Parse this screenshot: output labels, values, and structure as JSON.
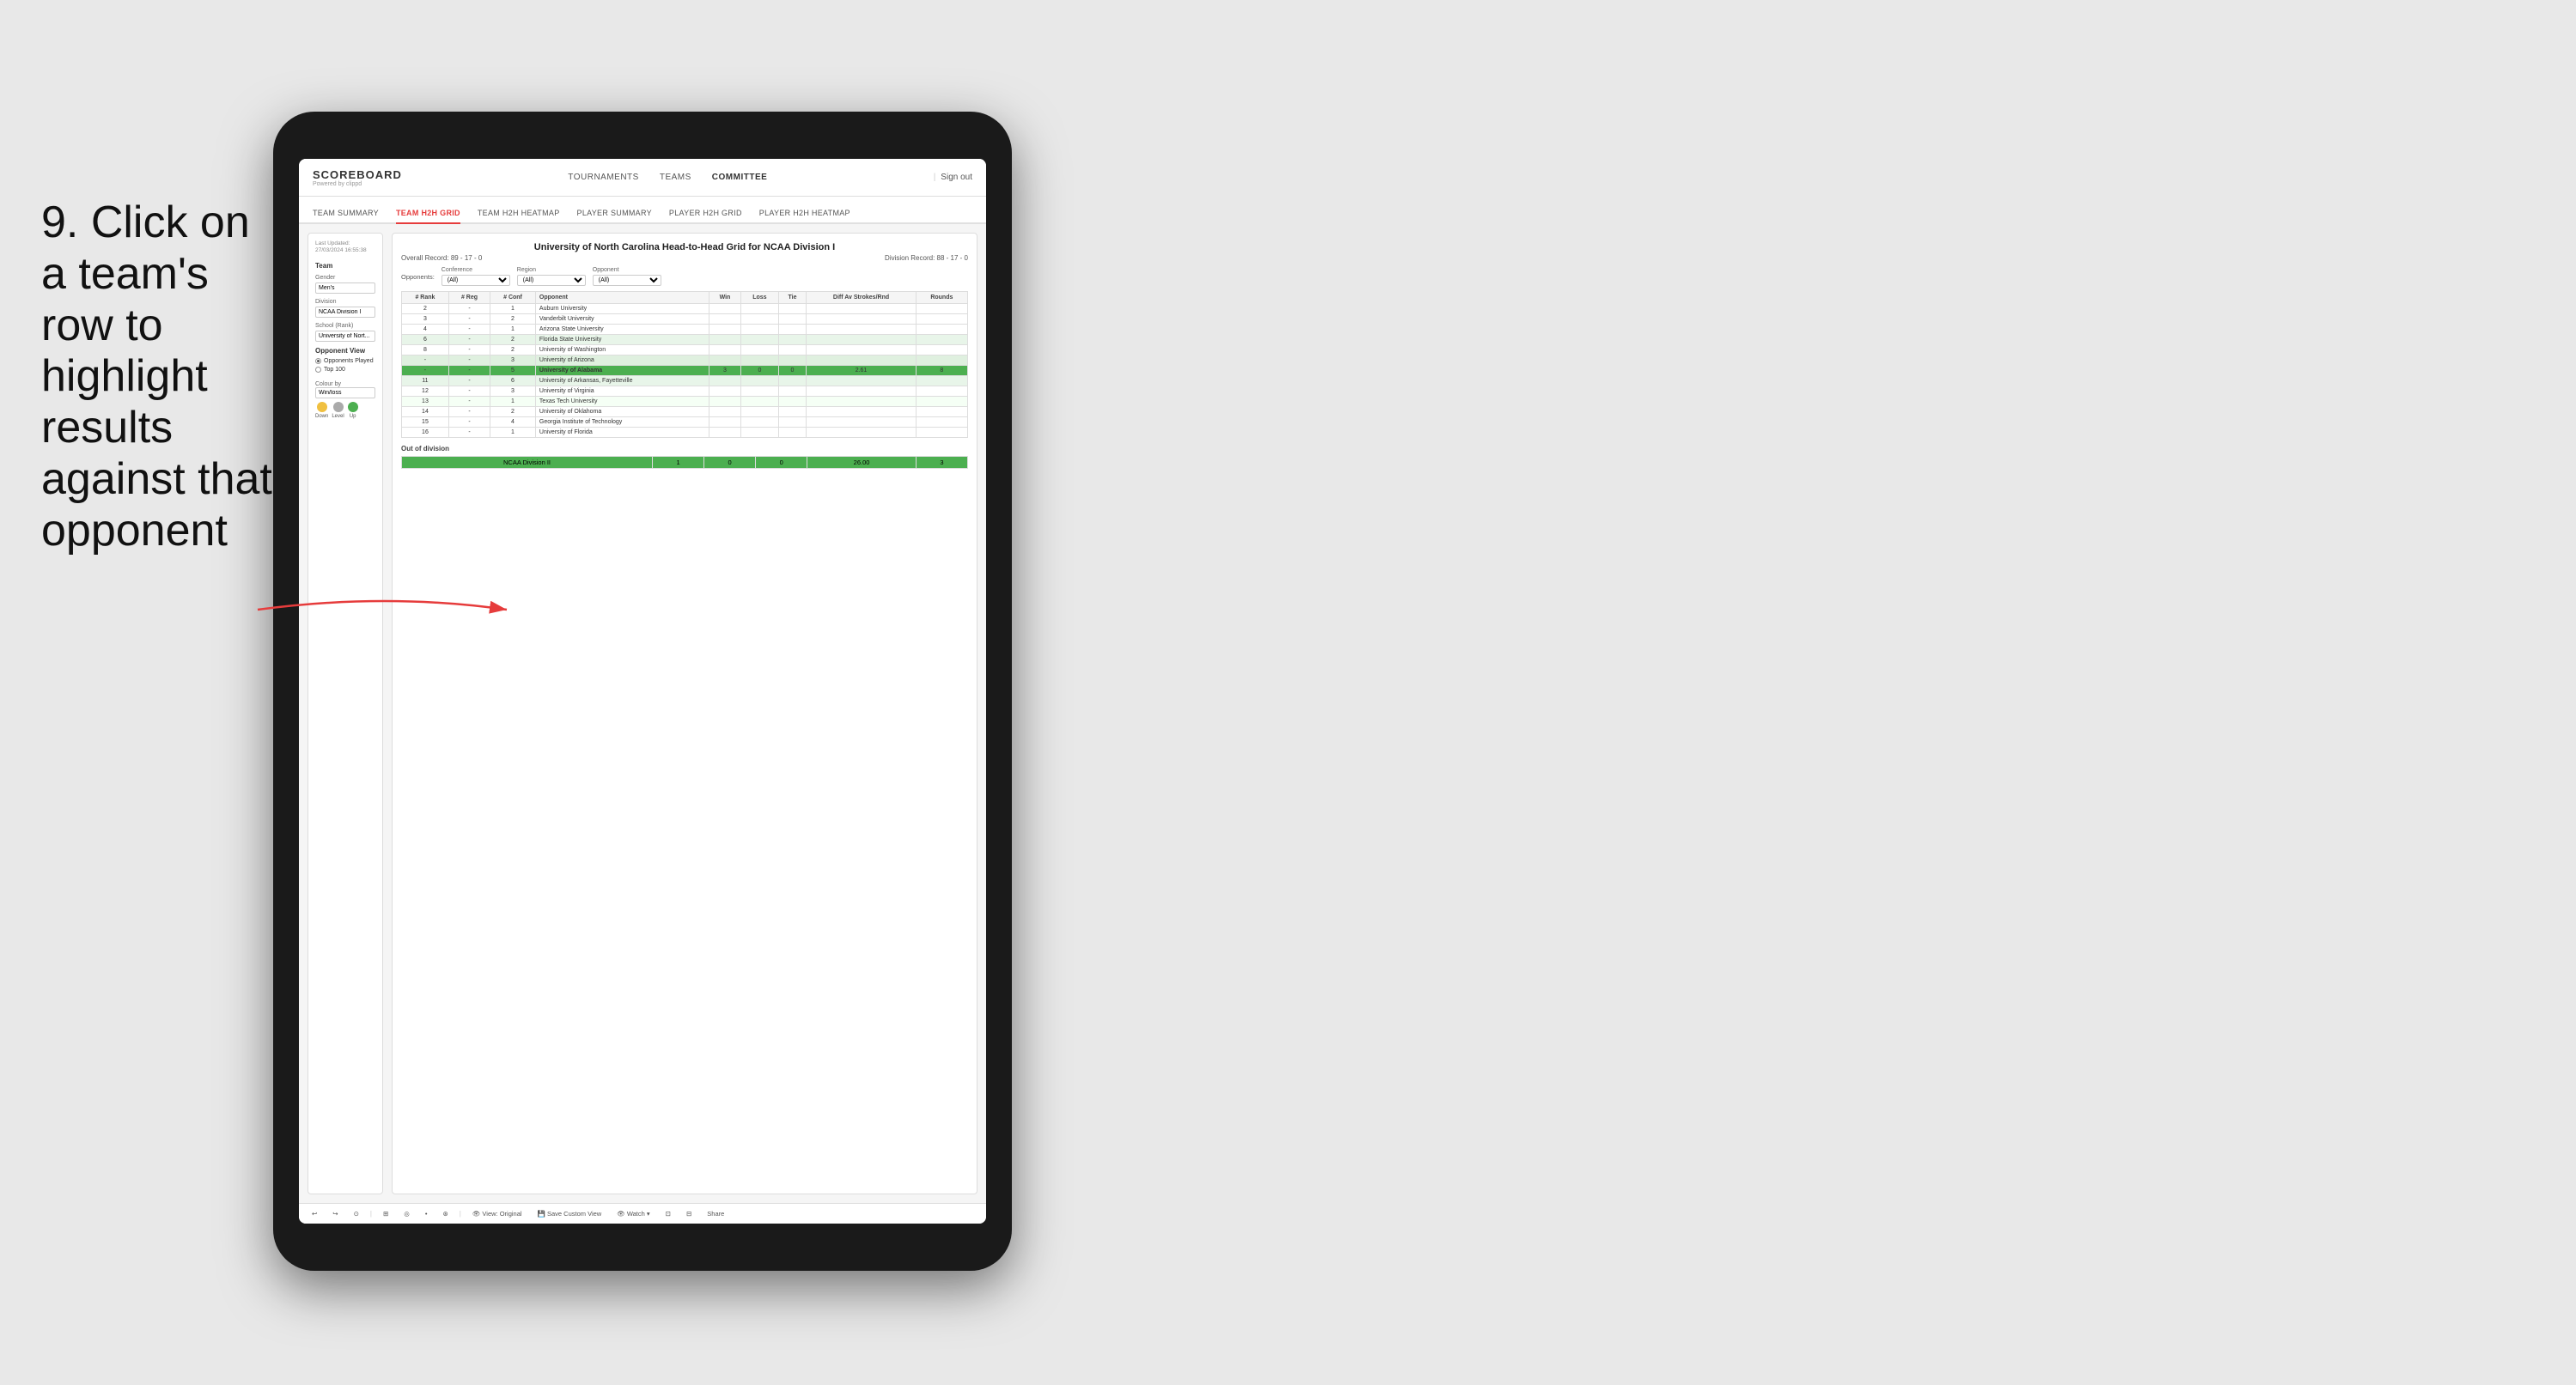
{
  "instruction": {
    "step": "9.",
    "text": "Click on a team's row to highlight results against that opponent"
  },
  "app": {
    "logo": "SCOREBOARD",
    "logo_sub": "Powered by clippd",
    "nav": {
      "items": [
        "TOURNAMENTS",
        "TEAMS",
        "COMMITTEE"
      ],
      "active": "COMMITTEE",
      "sign_out": "Sign out"
    },
    "sub_nav": {
      "items": [
        "TEAM SUMMARY",
        "TEAM H2H GRID",
        "TEAM H2H HEATMAP",
        "PLAYER SUMMARY",
        "PLAYER H2H GRID",
        "PLAYER H2H HEATMAP"
      ],
      "active": "TEAM H2H GRID"
    }
  },
  "sidebar": {
    "timestamp": "Last Updated: 27/03/2024\n16:55:38",
    "team_label": "Team",
    "gender_label": "Gender",
    "gender_value": "Men's",
    "division_label": "Division",
    "division_value": "NCAA Division I",
    "school_label": "School (Rank)",
    "school_value": "University of Nort...",
    "opponent_view_label": "Opponent View",
    "radio_options": [
      "Opponents Played",
      "Top 100"
    ],
    "radio_selected": "Opponents Played",
    "colour_label": "Colour by",
    "colour_value": "Win/loss",
    "legend": [
      {
        "label": "Down",
        "color": "#f0c040"
      },
      {
        "label": "Level",
        "color": "#aaaaaa"
      },
      {
        "label": "Up",
        "color": "#4caf50"
      }
    ]
  },
  "grid": {
    "title": "University of North Carolina Head-to-Head Grid for NCAA Division I",
    "overall_record_label": "Overall Record:",
    "overall_record": "89 - 17 - 0",
    "division_record_label": "Division Record:",
    "division_record": "88 - 17 - 0",
    "filters": {
      "opponents_label": "Opponents:",
      "conference_label": "Conference",
      "conference_value": "(All)",
      "region_label": "Region",
      "region_value": "(All)",
      "opponent_label": "Opponent",
      "opponent_value": "(All)"
    },
    "table_headers": [
      "# Rank",
      "# Reg",
      "# Conf",
      "Opponent",
      "Win",
      "Loss",
      "Tie",
      "Diff Av Strokes/Rnd",
      "Rounds"
    ],
    "rows": [
      {
        "rank": "2",
        "reg": "-",
        "conf": "1",
        "opponent": "Auburn University",
        "win": "",
        "loss": "",
        "tie": "",
        "diff": "",
        "rounds": "",
        "style": ""
      },
      {
        "rank": "3",
        "reg": "-",
        "conf": "2",
        "opponent": "Vanderbilt University",
        "win": "",
        "loss": "",
        "tie": "",
        "diff": "",
        "rounds": "",
        "style": ""
      },
      {
        "rank": "4",
        "reg": "-",
        "conf": "1",
        "opponent": "Arizona State University",
        "win": "",
        "loss": "",
        "tie": "",
        "diff": "",
        "rounds": "",
        "style": ""
      },
      {
        "rank": "6",
        "reg": "-",
        "conf": "2",
        "opponent": "Florida State University",
        "win": "",
        "loss": "",
        "tie": "",
        "diff": "",
        "rounds": "",
        "style": "light-green"
      },
      {
        "rank": "8",
        "reg": "-",
        "conf": "2",
        "opponent": "University of Washington",
        "win": "",
        "loss": "",
        "tie": "",
        "diff": "",
        "rounds": "",
        "style": ""
      },
      {
        "rank": "-",
        "reg": "-",
        "conf": "3",
        "opponent": "University of Arizona",
        "win": "",
        "loss": "",
        "tie": "",
        "diff": "",
        "rounds": "",
        "style": "light-green"
      },
      {
        "rank": "-",
        "reg": "-",
        "conf": "5",
        "opponent": "University of Alabama",
        "win": "3",
        "loss": "0",
        "tie": "0",
        "diff": "2.61",
        "rounds": "8",
        "style": "green-highlight"
      },
      {
        "rank": "11",
        "reg": "-",
        "conf": "6",
        "opponent": "University of Arkansas, Fayetteville",
        "win": "",
        "loss": "",
        "tie": "",
        "diff": "",
        "rounds": "",
        "style": "light-green"
      },
      {
        "rank": "12",
        "reg": "-",
        "conf": "3",
        "opponent": "University of Virginia",
        "win": "",
        "loss": "",
        "tie": "",
        "diff": "",
        "rounds": "",
        "style": ""
      },
      {
        "rank": "13",
        "reg": "-",
        "conf": "1",
        "opponent": "Texas Tech University",
        "win": "",
        "loss": "",
        "tie": "",
        "diff": "",
        "rounds": "",
        "style": "very-light-green"
      },
      {
        "rank": "14",
        "reg": "-",
        "conf": "2",
        "opponent": "University of Oklahoma",
        "win": "",
        "loss": "",
        "tie": "",
        "diff": "",
        "rounds": "",
        "style": ""
      },
      {
        "rank": "15",
        "reg": "-",
        "conf": "4",
        "opponent": "Georgia Institute of Technology",
        "win": "",
        "loss": "",
        "tie": "",
        "diff": "",
        "rounds": "",
        "style": ""
      },
      {
        "rank": "16",
        "reg": "-",
        "conf": "1",
        "opponent": "University of Florida",
        "win": "",
        "loss": "",
        "tie": "",
        "diff": "",
        "rounds": "",
        "style": ""
      }
    ],
    "out_of_division_label": "Out of division",
    "out_of_division_row": {
      "division": "NCAA Division II",
      "win": "1",
      "loss": "0",
      "tie": "0",
      "diff": "26.00",
      "rounds": "3"
    }
  },
  "toolbar": {
    "buttons": [
      "↩",
      "↪",
      "⊙",
      "⊞",
      "◎",
      "•",
      "⊛",
      "View: Original",
      "Save Custom View",
      "Watch ▾",
      "⊡",
      "⊟",
      "Share"
    ]
  }
}
